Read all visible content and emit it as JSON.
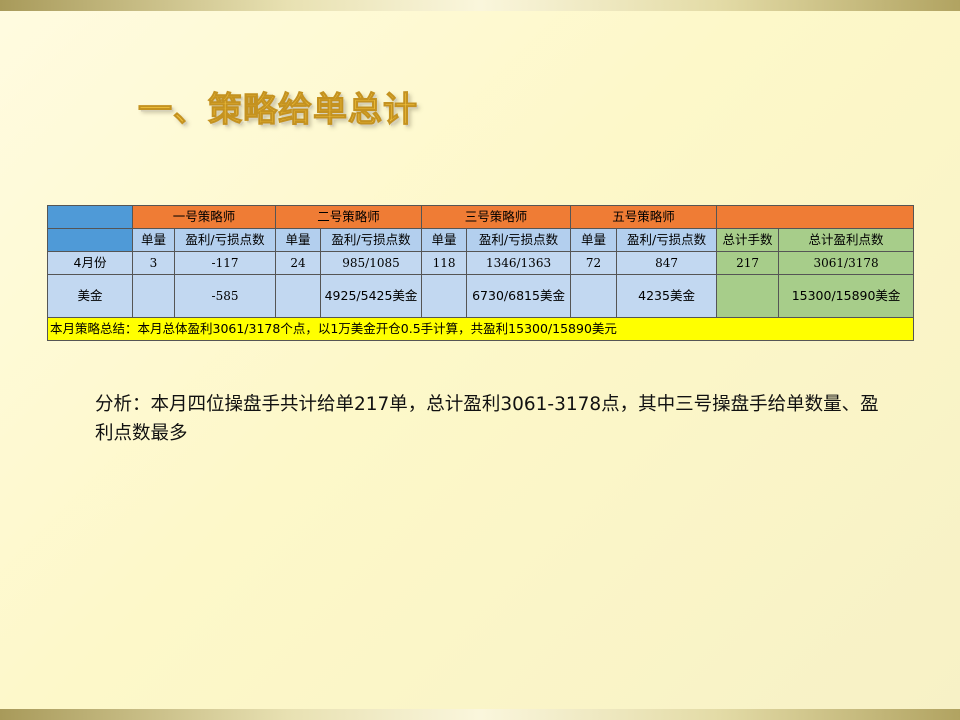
{
  "title": "一、策略给单总计",
  "table": {
    "header_groups": [
      "一号策略师",
      "二号策略师",
      "三号策略师",
      "五号策略师"
    ],
    "col_count_label": "单量",
    "col_points_label": "盈利/亏损点数",
    "total_hands_label": "总计手数",
    "total_points_label": "总计盈利点数",
    "row_april": {
      "label": "4月份",
      "s1_count": "3",
      "s1_points": "-117",
      "s2_count": "24",
      "s2_points": "985/1085",
      "s3_count": "118",
      "s3_points": "1346/1363",
      "s5_count": "72",
      "s5_points": "847",
      "total_hands": "217",
      "total_points": "3061/3178"
    },
    "row_usd": {
      "label": "美金",
      "s1_points": "-585",
      "s2_points": "4925/5425美金",
      "s3_points": "6730/6815美金",
      "s5_points": "4235美金",
      "total_points": "15300/15890美金"
    },
    "summary": "本月策略总结：本月总体盈利3061/3178个点，以1万美金开仓0.5手计算，共盈利15300/15890美元"
  },
  "analysis": "分析：本月四位操盘手共计给单217单，总计盈利3061-3178点，其中三号操盘手给单数量、盈利点数最多"
}
